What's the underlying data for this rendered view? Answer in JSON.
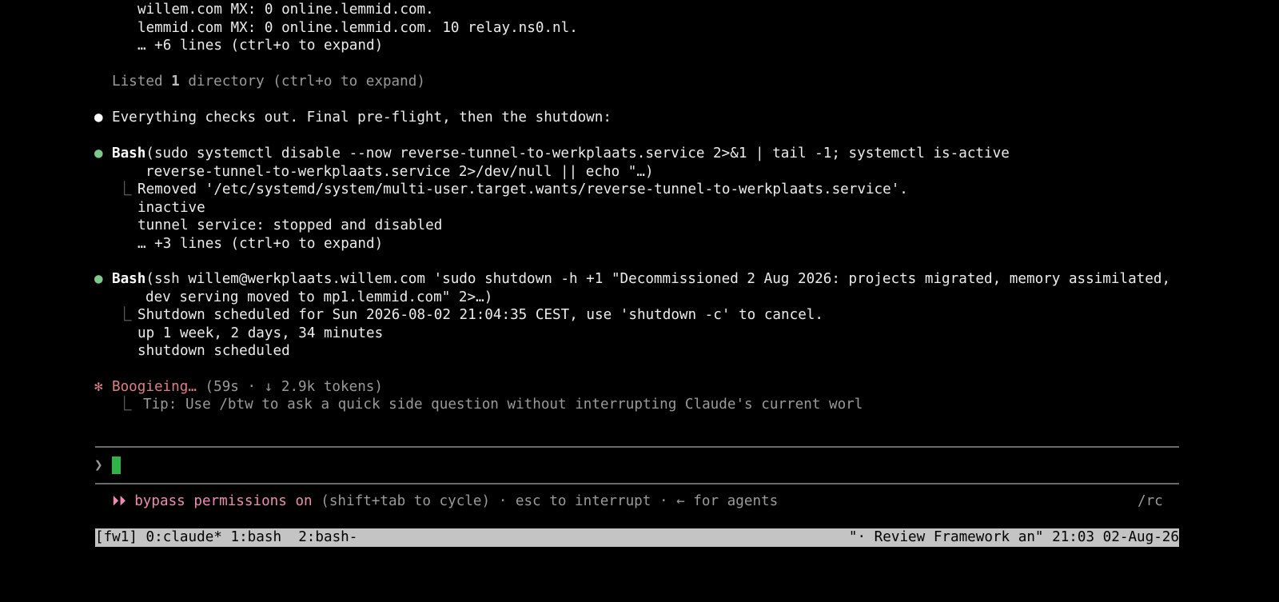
{
  "output_top": {
    "line1": "willem.com MX: 0 online.lemmid.com.",
    "line2": "lemmid.com MX: 0 online.lemmid.com. 10 relay.ns0.nl.",
    "line3": "… +6 lines (ctrl+o to expand)"
  },
  "listed": {
    "prefix": "Listed ",
    "count": "1",
    "suffix": " directory (ctrl+o to expand)"
  },
  "message": {
    "bullet": "●",
    "text": "Everything checks out. Final pre-flight, then the shutdown:"
  },
  "bash1": {
    "bullet": "●",
    "tool": "Bash",
    "cmd_line1": "(sudo systemctl disable --now reverse-tunnel-to-werkplaats.service 2>&1 | tail -1; systemctl is-active",
    "cmd_line2": "reverse-tunnel-to-werkplaats.service 2>/dev/null || echo \"…)",
    "corner": "⎿",
    "out1": "Removed '/etc/systemd/system/multi-user.target.wants/reverse-tunnel-to-werkplaats.service'.",
    "out2": "inactive",
    "out3": "tunnel service: stopped and disabled",
    "out4": "… +3 lines (ctrl+o to expand)"
  },
  "bash2": {
    "bullet": "●",
    "tool": "Bash",
    "cmd_line1": "(ssh willem@werkplaats.willem.com 'sudo shutdown -h +1 \"Decommissioned 2 Aug 2026: projects migrated, memory assimilated,",
    "cmd_line2": "dev serving moved to mp1.lemmid.com\" 2>…)",
    "corner": "⎿",
    "out1": "Shutdown scheduled for Sun 2026-08-02 21:04:35 CEST, use 'shutdown -c' to cancel.",
    "out2": "up 1 week, 2 days, 34 minutes",
    "out3": "shutdown scheduled"
  },
  "spinner": {
    "glyph": "✻",
    "label": "Boogieing…",
    "stats": " (59s · ↓ 2.9k tokens)",
    "corner": "⎿",
    "tip": "Tip: Use /btw to ask a quick side question without interrupting Claude's current worl"
  },
  "prompt": {
    "glyph": "❯"
  },
  "mode_bar": {
    "icon": "⏵⏵",
    "mode": " bypass permissions on",
    "rest": " (shift+tab to cycle) · esc to interrupt · ← for agents",
    "right": "/rc"
  },
  "tmux": {
    "left": "[fw1] 0:claude* 1:bash  2:bash-",
    "right": "\"· Review Framework an\" 21:03 02-Aug-26"
  },
  "colors": {
    "background": "#000000",
    "foreground": "#ececec",
    "dim": "#9a9a9a",
    "success_bullet": "#7ec98b",
    "spinner": "#e07e85",
    "bypass": "#f08ab4",
    "cursor": "#2fb24a",
    "status_bar": "#c4c4c4"
  }
}
